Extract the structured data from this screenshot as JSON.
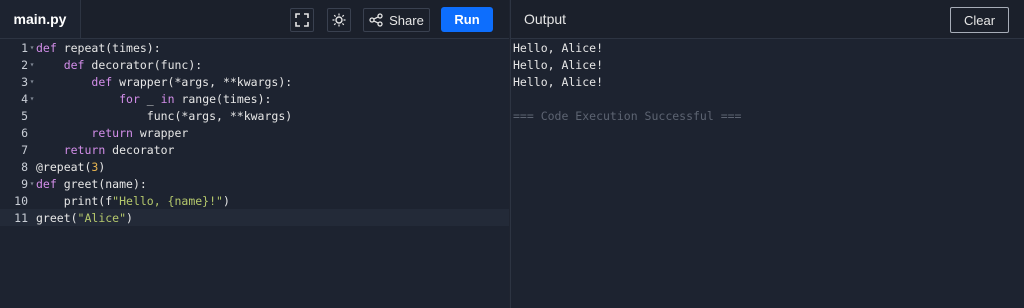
{
  "editor": {
    "tab_label": "main.py",
    "share_label": "Share",
    "run_label": "Run",
    "lines": [
      {
        "n": "1",
        "fold": "▾"
      },
      {
        "n": "2",
        "fold": "▾"
      },
      {
        "n": "3",
        "fold": "▾"
      },
      {
        "n": "4",
        "fold": "▾"
      },
      {
        "n": "5",
        "fold": ""
      },
      {
        "n": "6",
        "fold": ""
      },
      {
        "n": "7",
        "fold": ""
      },
      {
        "n": "8",
        "fold": ""
      },
      {
        "n": "9",
        "fold": "▾"
      },
      {
        "n": "10",
        "fold": ""
      },
      {
        "n": "11",
        "fold": ""
      }
    ],
    "code_text": [
      "def repeat(times):",
      "    def decorator(func):",
      "        def wrapper(*args, **kwargs):",
      "            for _ in range(times):",
      "                func(*args, **kwargs)",
      "        return wrapper",
      "    return decorator",
      "@repeat(3)",
      "def greet(name):",
      "    print(f\"Hello, {name}!\")",
      "greet(\"Alice\")"
    ]
  },
  "output": {
    "title": "Output",
    "clear_label": "Clear",
    "lines": [
      "Hello, Alice!",
      "Hello, Alice!",
      "Hello, Alice!",
      "",
      "=== Code Execution Successful ==="
    ]
  },
  "colors": {
    "run_button": "#0d6efd",
    "background": "#1d2330",
    "keyword": "#d38ee9",
    "string": "#b5c86c",
    "number": "#e6b450"
  },
  "icons": [
    "fullscreen-icon",
    "theme-toggle-icon",
    "share-icon"
  ]
}
